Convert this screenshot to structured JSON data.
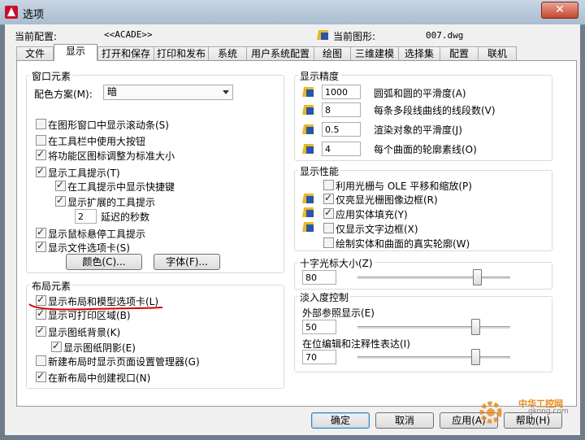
{
  "window": {
    "title": "选项",
    "close": "✕"
  },
  "header": {
    "current_config_label": "当前配置:",
    "current_config_value": "<<ACADE>>",
    "current_drawing_label": "当前图形:",
    "current_drawing_value": "007.dwg"
  },
  "tabs": [
    "文件",
    "显示",
    "打开和保存",
    "打印和发布",
    "系统",
    "用户系统配置",
    "绘图",
    "三维建模",
    "选择集",
    "配置",
    "联机"
  ],
  "window_elements": {
    "title": "窗口元素",
    "color_scheme_label": "配色方案(M):",
    "color_scheme_value": "暗",
    "show_scrollbars": "在图形窗口中显示滚动条(S)",
    "large_buttons": "在工具栏中使用大按钮",
    "resize_ribbon": "将功能区图标调整为标准大小",
    "show_tooltips": "显示工具提示(T)",
    "show_shortcuts": "在工具提示中显示快捷键",
    "show_extended": "显示扩展的工具提示",
    "delay_value": "2",
    "delay_label": "延迟的秒数",
    "rollover_tooltips": "显示鼠标悬停工具提示",
    "file_tabs": "显示文件选项卡(S)",
    "colors_button": "颜色(C)...",
    "fonts_button": "字体(F)..."
  },
  "layout_elements": {
    "title": "布局元素",
    "layout_model_tabs": "显示布局和模型选项卡(L)",
    "printable_area": "显示可打印区域(B)",
    "paper_background": "显示图纸背景(K)",
    "paper_shadow": "显示图纸阴影(E)",
    "page_setup_manager": "新建布局时显示页面设置管理器(G)",
    "create_viewport": "在新布局中创建视口(N)"
  },
  "display_resolution": {
    "title": "显示精度",
    "rows": [
      {
        "value": "1000",
        "label": "圆弧和圆的平滑度(A)"
      },
      {
        "value": "8",
        "label": "每条多段线曲线的线段数(V)"
      },
      {
        "value": "0.5",
        "label": "渲染对象的平滑度(J)"
      },
      {
        "value": "4",
        "label": "每个曲面的轮廓素线(O)"
      }
    ]
  },
  "display_performance": {
    "title": "显示性能",
    "pan_zoom": "利用光栅与 OLE 平移和缩放(P)",
    "highlight_raster": "仅亮显光栅图像边框(R)",
    "apply_fill": "应用实体填充(Y)",
    "text_frame": "仅显示文字边框(X)",
    "true_silhouettes": "绘制实体和曲面的真实轮廓(W)"
  },
  "crosshair": {
    "title": "十字光标大小(Z)",
    "value": "80",
    "level": 0.8
  },
  "fade": {
    "title": "淡入度控制",
    "xref_label": "外部参照显示(E)",
    "xref_value": "50",
    "xref_level": 0.5,
    "inplace_label": "在位编辑和注释性表达(I)",
    "inplace_value": "70",
    "inplace_level": 0.7
  },
  "buttons": {
    "ok": "确定",
    "cancel": "取消",
    "apply": "应用(A)",
    "help": "帮助(H)"
  },
  "watermark": {
    "text": "中华工控网",
    "url": "gkong.com"
  },
  "colors": {
    "titlebar": "#b7c8d9",
    "annotation_red": "#d40000",
    "close": "#c7452d"
  }
}
